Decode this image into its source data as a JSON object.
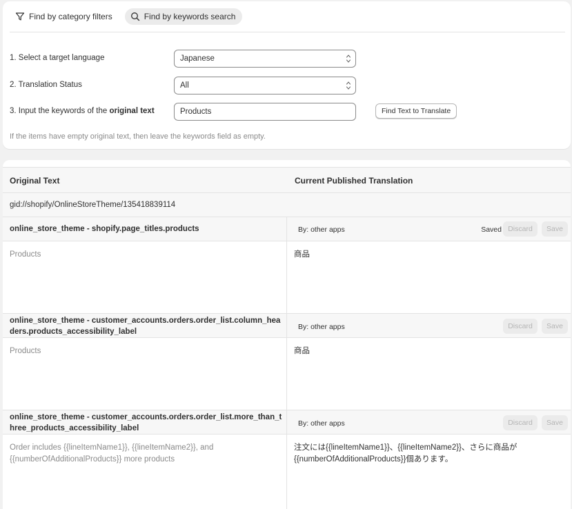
{
  "tabs": {
    "category_label": "Find by category filters",
    "keywords_label": "Find by keywords search"
  },
  "form": {
    "language_label": "1. Select a target language",
    "language_value": "Japanese",
    "status_label": "2. Translation Status",
    "status_value": "All",
    "keywords_label_prefix": "3. Input the keywords of the ",
    "keywords_label_bold": "original text",
    "keywords_value": "Products",
    "find_button": "Find Text to Translate",
    "hint": "If the items have empty original text, then leave the keywords field as empty."
  },
  "table": {
    "col_original": "Original Text",
    "col_translation": "Current Published Translation",
    "gid": "gid://shopify/OnlineStoreTheme/135418839114",
    "rows": [
      {
        "key": "online_store_theme - shopify.page_titles.products",
        "by": "By: other apps",
        "status": "Saved",
        "discard": "Discard",
        "save": "Save",
        "original": "Products",
        "translation": "商品"
      },
      {
        "key": "online_store_theme - customer_accounts.orders.order_list.column_headers.products_accessibility_label",
        "by": "By: other apps",
        "status": "",
        "discard": "Discard",
        "save": "Save",
        "original": "Products",
        "translation": "商品"
      },
      {
        "key": "online_store_theme - customer_accounts.orders.order_list.more_than_three_products_accessibility_label",
        "by": "By: other apps",
        "status": "",
        "discard": "Discard",
        "save": "Save",
        "original": "Order includes {{lineItemName1}}, {{lineItemName2}}, and {{numberOfAdditionalProducts}} more products",
        "translation": "注文には{{lineItemName1}}、{{lineItemName2}}、さらに商品が{{numberOfAdditionalProducts}}個あります。"
      }
    ]
  },
  "colors": {
    "background": "#f1f1f1",
    "card": "#ffffff",
    "muted_text": "#8a8a8a",
    "disabled_button": "#ebebeb"
  }
}
